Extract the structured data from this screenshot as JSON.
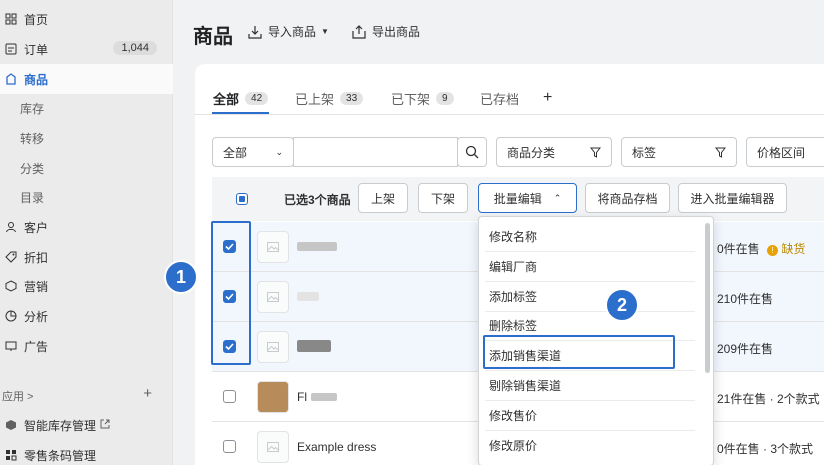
{
  "sidebar": {
    "items": [
      {
        "label": "首页",
        "icon": "home-icon"
      },
      {
        "label": "订单",
        "icon": "order-icon",
        "badge": "1,044"
      },
      {
        "label": "商品",
        "icon": "tag-icon",
        "active": true
      },
      {
        "label": "客户",
        "icon": "person-icon"
      },
      {
        "label": "折扣",
        "icon": "discount-icon"
      },
      {
        "label": "营销",
        "icon": "marketing-icon"
      },
      {
        "label": "分析",
        "icon": "analytics-icon"
      },
      {
        "label": "广告",
        "icon": "ads-icon"
      }
    ],
    "sub_items": [
      "库存",
      "转移",
      "分类",
      "目录"
    ],
    "apps_label": "应用 >",
    "apps": [
      {
        "label": "智能库存管理",
        "icon": "app-box-icon"
      },
      {
        "label": "零售条码管理",
        "icon": "barcode-icon"
      }
    ]
  },
  "header": {
    "title": "商品",
    "import_label": "导入商品",
    "export_label": "导出商品"
  },
  "tabs": [
    {
      "label": "全部",
      "count": "42",
      "active": true
    },
    {
      "label": "已上架",
      "count": "33"
    },
    {
      "label": "已下架",
      "count": "9"
    },
    {
      "label": "已存档",
      "count": ""
    }
  ],
  "filters": {
    "scope": "全部",
    "category": "商品分类",
    "tags": "标签",
    "price": "价格区间"
  },
  "bulk": {
    "selected_text": "已选3个商品",
    "publish": "上架",
    "unpublish": "下架",
    "bulk_edit": "批量编辑",
    "archive": "将商品存档",
    "open_editor": "进入批量编辑器"
  },
  "rows": [
    {
      "name": "",
      "inventory": "0件在售",
      "status": "缺货",
      "checked": true
    },
    {
      "name": "",
      "inventory": "210件在售",
      "status": "",
      "checked": true
    },
    {
      "name": "",
      "inventory": "209件在售",
      "status": "",
      "checked": true
    },
    {
      "name": "Fl",
      "inventory": "21件在售 · 2个款式",
      "status": "",
      "checked": false
    },
    {
      "name": "Example dress",
      "inventory": "0件在售 · 3个款式",
      "status": "",
      "checked": false
    }
  ],
  "dropdown": [
    "修改名称",
    "编辑厂商",
    "添加标签",
    "删除标签",
    "添加销售渠道",
    "剔除销售渠道",
    "修改售价",
    "修改原价"
  ],
  "annotations": [
    "1",
    "2"
  ],
  "colors": {
    "accent": "#2c6ecb",
    "warning": "#e8a200"
  }
}
